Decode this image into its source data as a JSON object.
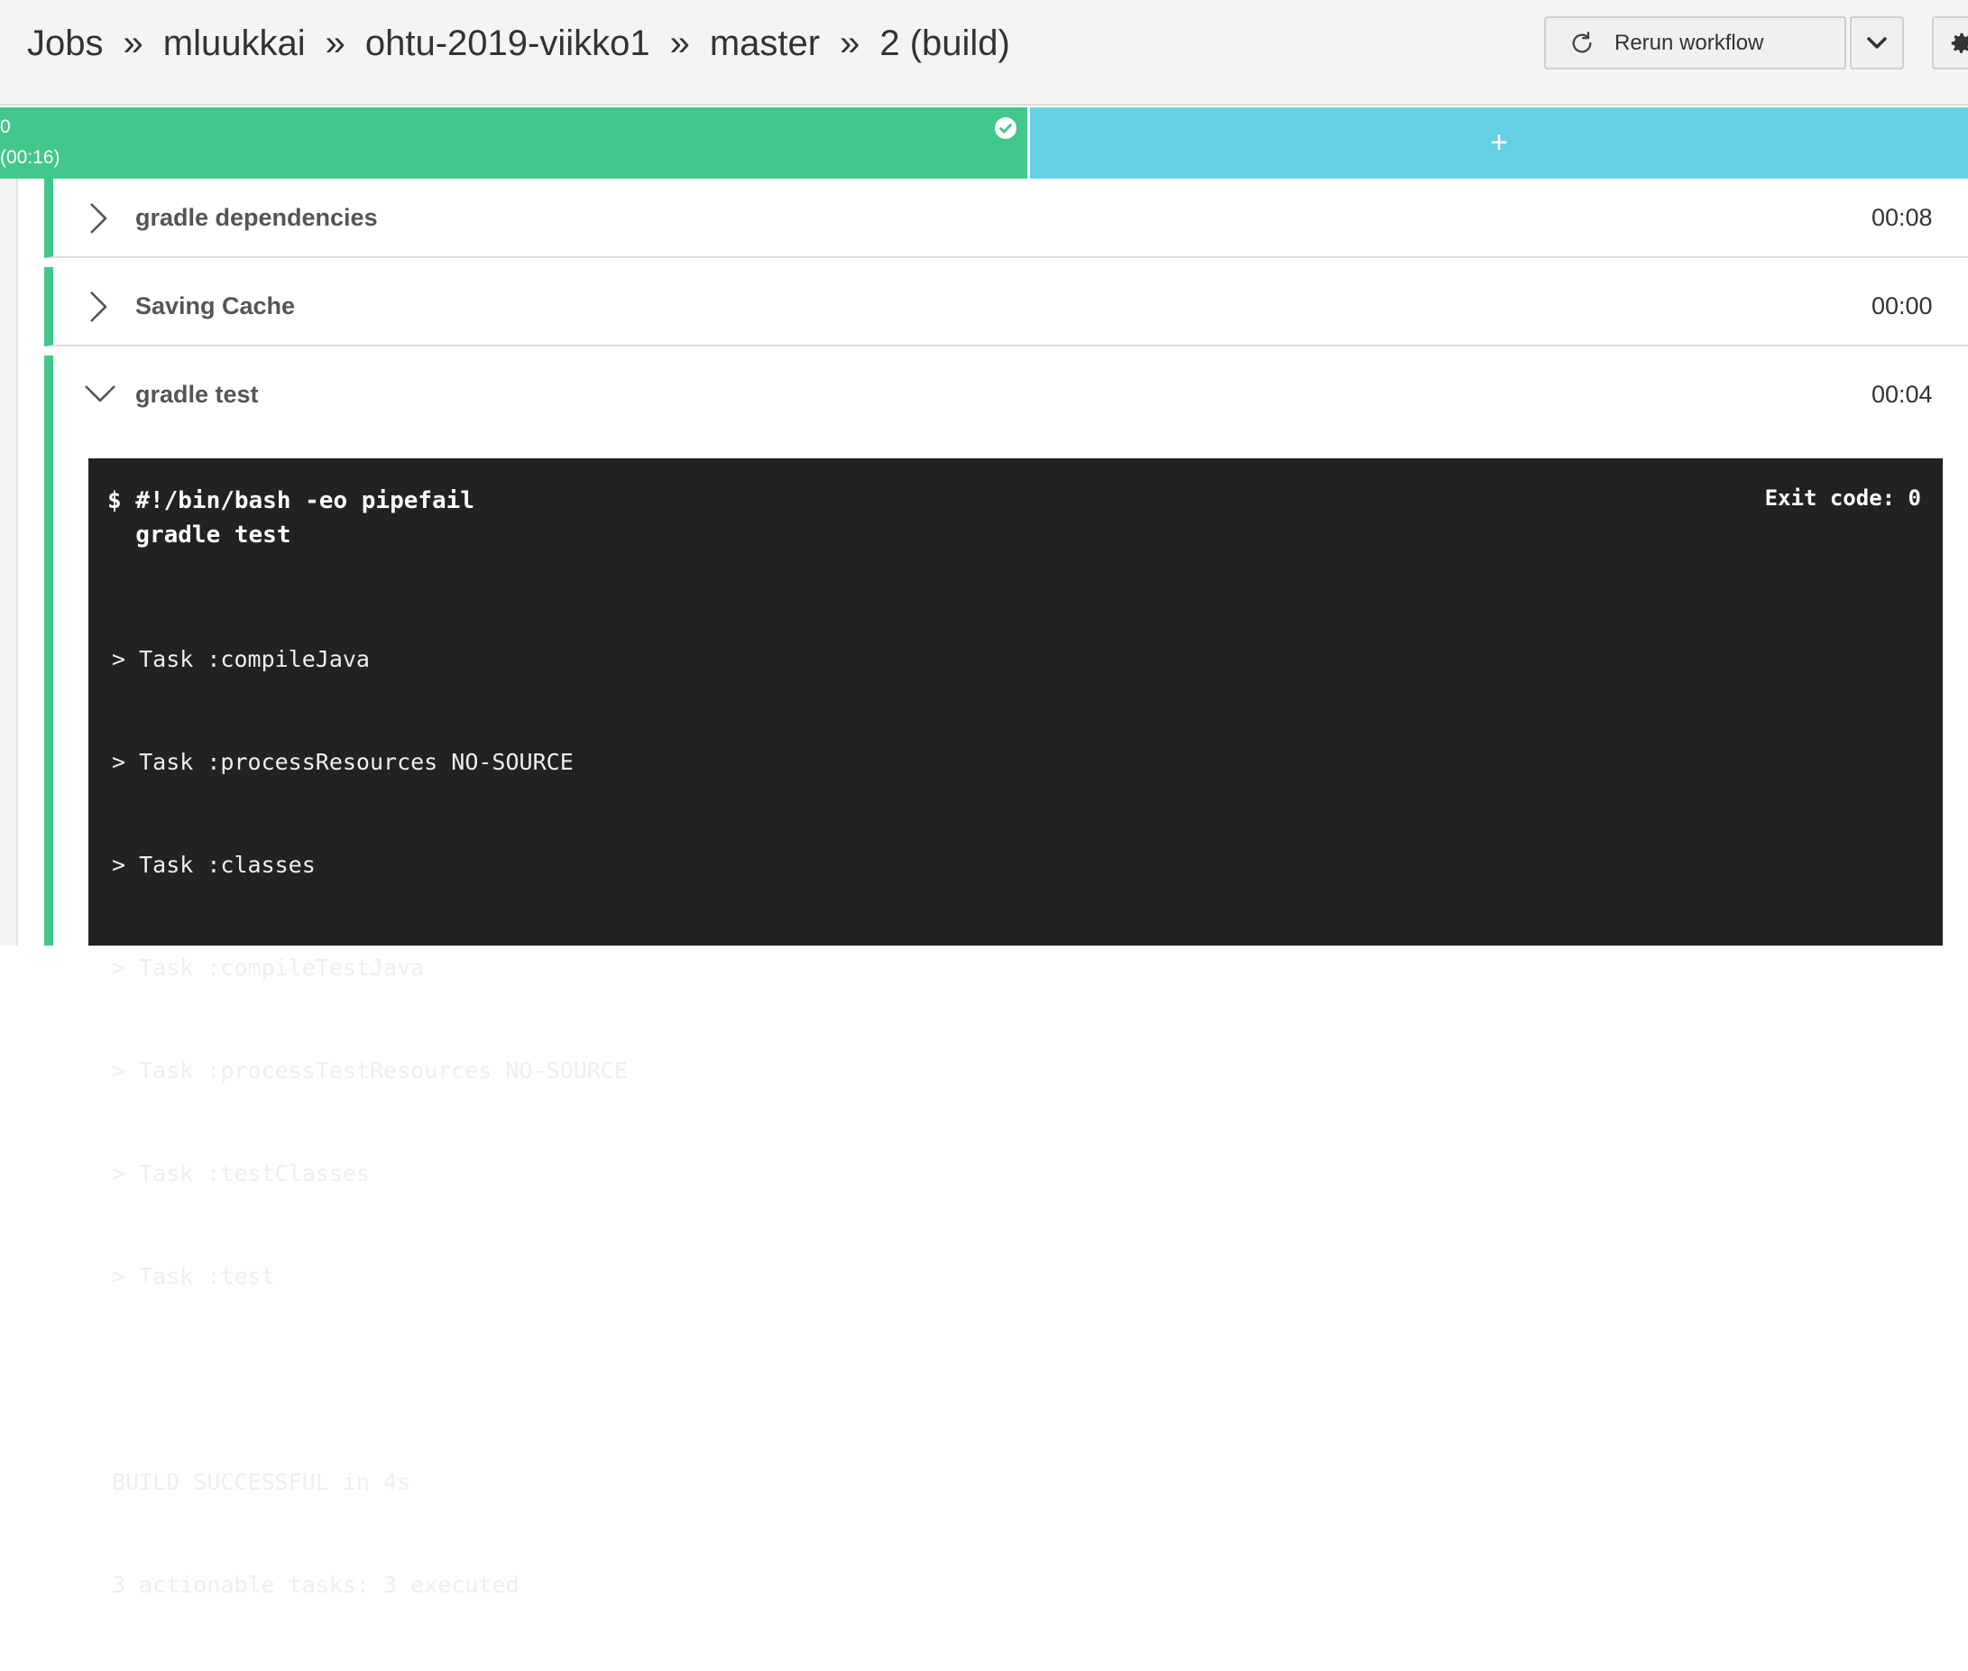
{
  "breadcrumb": {
    "items": [
      "Jobs",
      "mluukkai",
      "ohtu-2019-viikko1",
      "master",
      "2 (build)"
    ],
    "separator": "»"
  },
  "toolbar": {
    "rerun_label": "Rerun workflow",
    "rerun_icon": "refresh-icon",
    "dropdown_icon": "chevron-down-icon",
    "settings_icon": "gear-icon"
  },
  "parallel": {
    "run_index": "0",
    "run_time": "(00:16)",
    "status_icon": "check-circle-icon",
    "add_label": "+",
    "colors": {
      "success": "#42c88a",
      "add": "#65d2e4"
    }
  },
  "steps": [
    {
      "name": "gradle dependencies",
      "time": "00:08",
      "expanded": false
    },
    {
      "name": "Saving Cache",
      "time": "00:00",
      "expanded": false
    },
    {
      "name": "gradle test",
      "time": "00:04",
      "expanded": true
    }
  ],
  "terminal": {
    "command_line_1": "$ #!/bin/bash -eo pipefail",
    "command_line_2": "  gradle test",
    "exit_code": "Exit code: 0",
    "output": [
      "> Task :compileJava",
      "> Task :processResources NO-SOURCE",
      "> Task :classes",
      "> Task :compileTestJava",
      "> Task :processTestResources NO-SOURCE",
      "> Task :testClasses",
      "> Task :test",
      "",
      "BUILD SUCCESSFUL in 4s",
      "3 actionable tasks: 3 executed"
    ]
  }
}
